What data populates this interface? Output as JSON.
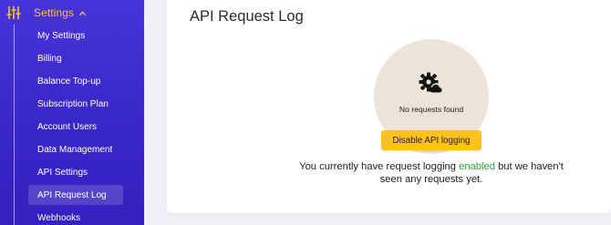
{
  "sidebar": {
    "section_label": "Settings",
    "items": [
      {
        "label": "My Settings",
        "active": false
      },
      {
        "label": "Billing",
        "active": false
      },
      {
        "label": "Balance Top-up",
        "active": false
      },
      {
        "label": "Subscription Plan",
        "active": false
      },
      {
        "label": "Account Users",
        "active": false
      },
      {
        "label": "Data Management",
        "active": false
      },
      {
        "label": "API Settings",
        "active": false
      },
      {
        "label": "API Request Log",
        "active": true
      },
      {
        "label": "Webhooks",
        "active": false
      }
    ]
  },
  "main": {
    "title": "API Request Log",
    "empty_state": {
      "icon": "gear-icon",
      "message": "No requests found",
      "button_label": "Disable API logging"
    },
    "info": {
      "prefix": "You currently have request logging",
      "status": "enabled",
      "suffix": "but we haven't seen any requests yet."
    }
  },
  "colors": {
    "sidebar_bg": "#4634d8",
    "accent": "#ffc233",
    "button_bg": "#ffc21a",
    "enabled": "#2e9e3b",
    "circle_bg": "#ece3d9"
  }
}
